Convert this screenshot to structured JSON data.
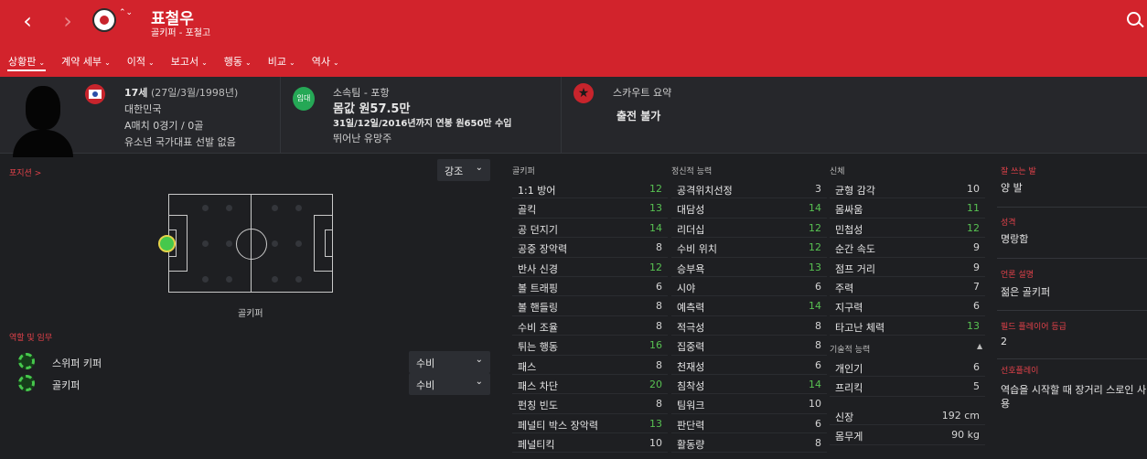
{
  "header": {
    "back_icon": "chevron-left-icon",
    "forward_icon": "chevron-right-icon",
    "player_name": "표철우",
    "player_subtitle": "골키퍼 - 포철고",
    "arrows": "⌃⌄",
    "colors": {
      "bar": "#d2232c",
      "accent_green": "#58c252"
    }
  },
  "tabs": [
    {
      "label": "상황판",
      "has_menu": true,
      "active": true
    },
    {
      "label": "계약 세부",
      "has_menu": true
    },
    {
      "label": "이적",
      "has_menu": true
    },
    {
      "label": "보고서",
      "has_menu": true
    },
    {
      "label": "행동",
      "has_menu": true
    },
    {
      "label": "비교",
      "has_menu": true
    },
    {
      "label": "역사",
      "has_menu": true
    }
  ],
  "info": {
    "age": "17세",
    "birth": "(27일/3월/1998년)",
    "nationality": "대한민국",
    "a_matches": "A매치 0경기 / 0골",
    "youth": "유소년 국가대표 선발 없음",
    "loan_badge": "임대",
    "club": "소속팀 - 포항",
    "value": "몸값 원57.5만",
    "contract": "31일/12일/2016년까지 연봉 원650만 수입",
    "prospect": "뛰어난 유망주",
    "scout_title": "스카우트 요약",
    "scout_status": "출전 불가"
  },
  "position": {
    "title": "포지션 >",
    "highlight_dropdown": "강조",
    "position_name": "골키퍼"
  },
  "roles": {
    "title": "역할 및 임무",
    "items": [
      {
        "name": "스위퍼 키퍼",
        "duty": "수비"
      },
      {
        "name": "골키퍼",
        "duty": "수비"
      }
    ]
  },
  "attributes": {
    "goalkeeping_title": "골키퍼",
    "goalkeeping": [
      {
        "name": "1:1 방어",
        "value": "12",
        "high": true
      },
      {
        "name": "골킥",
        "value": "13",
        "high": true
      },
      {
        "name": "공 던지기",
        "value": "14",
        "high": true
      },
      {
        "name": "공중 장악력",
        "value": "8"
      },
      {
        "name": "반사 신경",
        "value": "12",
        "high": true
      },
      {
        "name": "볼 트래핑",
        "value": "6"
      },
      {
        "name": "볼 핸들링",
        "value": "8"
      },
      {
        "name": "수비 조율",
        "value": "8"
      },
      {
        "name": "튀는 행동",
        "value": "16",
        "high": true
      },
      {
        "name": "패스",
        "value": "8"
      },
      {
        "name": "패스 차단",
        "value": "20",
        "high": true
      },
      {
        "name": "펀칭 빈도",
        "value": "8"
      },
      {
        "name": "페널티 박스 장악력",
        "value": "13",
        "high": true
      },
      {
        "name": "페널티킥",
        "value": "10"
      }
    ],
    "mental_title": "정신적 능력",
    "mental": [
      {
        "name": "공격위치선정",
        "value": "3"
      },
      {
        "name": "대담성",
        "value": "14",
        "high": true
      },
      {
        "name": "리더십",
        "value": "12",
        "high": true
      },
      {
        "name": "수비 위치",
        "value": "12",
        "high": true
      },
      {
        "name": "승부욕",
        "value": "13",
        "high": true
      },
      {
        "name": "시야",
        "value": "6"
      },
      {
        "name": "예측력",
        "value": "14",
        "high": true
      },
      {
        "name": "적극성",
        "value": "8"
      },
      {
        "name": "집중력",
        "value": "8"
      },
      {
        "name": "천재성",
        "value": "6"
      },
      {
        "name": "침착성",
        "value": "14",
        "high": true
      },
      {
        "name": "팀워크",
        "value": "10"
      },
      {
        "name": "판단력",
        "value": "6"
      },
      {
        "name": "활동량",
        "value": "8"
      }
    ],
    "physical_title": "신체",
    "physical": [
      {
        "name": "균형 감각",
        "value": "10"
      },
      {
        "name": "몸싸움",
        "value": "11",
        "high": true
      },
      {
        "name": "민첩성",
        "value": "12",
        "high": true
      },
      {
        "name": "순간 속도",
        "value": "9"
      },
      {
        "name": "점프 거리",
        "value": "9"
      },
      {
        "name": "주력",
        "value": "7"
      },
      {
        "name": "지구력",
        "value": "6"
      },
      {
        "name": "타고난 체력",
        "value": "13",
        "high": true
      }
    ],
    "technical_title": "기술적 능력",
    "technical": [
      {
        "name": "개인기",
        "value": "6"
      },
      {
        "name": "프리킥",
        "value": "5"
      }
    ],
    "height_label": "신장",
    "height_value": "192 cm",
    "weight_label": "몸무게",
    "weight_value": "90 kg"
  },
  "side": {
    "foot_label": "잘 쓰는 발",
    "foot_value": "양 발",
    "personality_label": "성격",
    "personality_value": "명랑함",
    "media_label": "언론 설명",
    "media_value": "젊은 골키퍼",
    "playing_grade_label": "필드 플레이어 등급",
    "playing_grade_value": "2",
    "preferred_label": "선호플레이",
    "preferred_value": "역습을 시작할 때 장거리 스로인 사용"
  }
}
